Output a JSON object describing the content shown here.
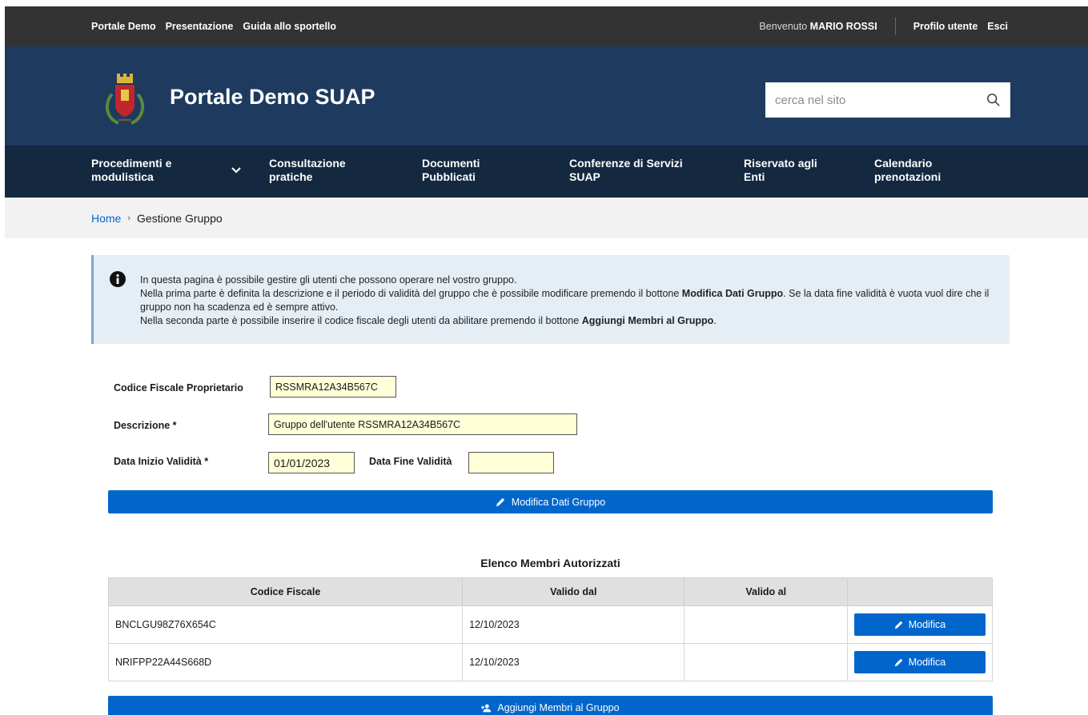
{
  "topbar": {
    "links": [
      "Portale Demo",
      "Presentazione",
      "Guida allo sportello"
    ],
    "welcome_prefix": "Benvenuto",
    "user_name": "MARIO ROSSI",
    "profile_label": "Profilo utente",
    "logout_label": "Esci"
  },
  "header": {
    "title": "Portale Demo SUAP",
    "search_placeholder": "cerca nel sito"
  },
  "nav": {
    "items": [
      "Procedimenti e\nmodulistica",
      "Consultazione\npratiche",
      "Documenti\nPubblicati",
      "Conferenze di Servizi\nSUAP",
      "Riservato agli\nEnti",
      "Calendario\nprenotazioni"
    ]
  },
  "breadcrumb": {
    "home": "Home",
    "separator": "›",
    "current": "Gestione Gruppo"
  },
  "info": {
    "line1": "In questa pagina è possibile gestire gli utenti che possono operare nel vostro gruppo.",
    "line2_a": "Nella prima parte è definita la descrizione e il periodo di validità del gruppo che è possibile modificare premendo il bottone ",
    "line2_b": "Modifica Dati Gruppo",
    "line2_c": ". Se la data fine validità è vuota vuol dire che il gruppo non ha scadenza ed è sempre attivo.",
    "line3_a": "Nella seconda parte è possibile inserire il codice fiscale degli utenti da abilitare premendo il bottone ",
    "line3_b": "Aggiungi Membri al Gruppo",
    "line3_c": "."
  },
  "form": {
    "owner_label": "Codice Fiscale Proprietario",
    "owner_value": "RSSMRA12A34B567C",
    "description_label": "Descrizione *",
    "description_value": "Gruppo dell'utente RSSMRA12A34B567C",
    "start_label": "Data Inizio Validità *",
    "start_value": "01/01/2023",
    "end_label": "Data Fine Validità",
    "end_value": "",
    "edit_button": "Modifica Dati Gruppo"
  },
  "members": {
    "title": "Elenco Membri Autorizzati",
    "columns": [
      "Codice Fiscale",
      "Valido dal",
      "Valido al",
      ""
    ],
    "rows": [
      {
        "cf": "BNCLGU98Z76X654C",
        "from": "12/10/2023",
        "to": "",
        "action": "Modifica"
      },
      {
        "cf": "NRIFPP22A44S668D",
        "from": "12/10/2023",
        "to": "",
        "action": "Modifica"
      }
    ],
    "add_button": "Aggiungi Membri al Gruppo"
  },
  "colors": {
    "topbar": "#333333",
    "header": "#1e3a5f",
    "nav": "#142840",
    "primary": "#0066cc",
    "field_bg": "#ffffd8"
  }
}
